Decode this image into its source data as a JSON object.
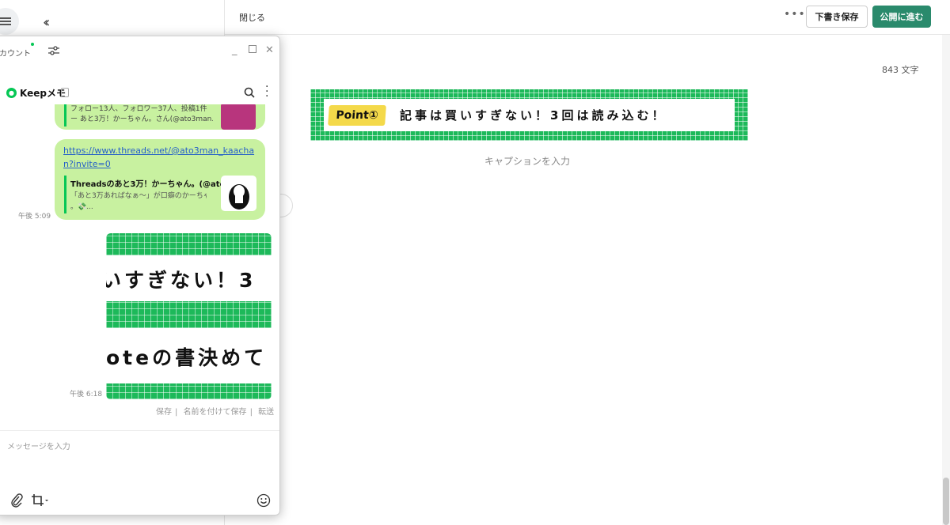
{
  "editor": {
    "close_label": "閉じる",
    "more_icon": "ellipsis-icon",
    "draft_label": "下書き保存",
    "publish_label": "公開に進む",
    "char_count": "843 文字",
    "caption_placeholder": "キャプションを入力",
    "banner": {
      "badge": "Point①",
      "text": "記事は買いすぎない！3回は読み込む！"
    },
    "colors": {
      "publish": "#2a8a6c",
      "banner_green": "#1db95a",
      "badge_yellow": "#f4d94a"
    }
  },
  "chat": {
    "account_label": "カウント",
    "title": "Keepメモ",
    "messages": {
      "top_partial_line1": "フォロー13人、フォロワー37人、投稿1件",
      "top_partial_line2": "ー あと3万！かーちゃん。さん(@ato3man...",
      "threads_link": "https://www.threads.net/@ato3man_kaachan?invite=0",
      "threads_title": "Threadsのあと3万！かーちゃん。(@ato...",
      "threads_desc_line1": "「あと3万あればなぁ〜」が口癖のかーちゃん",
      "threads_desc_line2": "。💸...",
      "threads_time": "午後 5:09",
      "image_text_line1": "いすぎない！3",
      "image_text_line2": "oteの書決めて",
      "image_time": "午後 6:18"
    },
    "actions": {
      "save": "保存",
      "save_as": "名前を付けて保存",
      "forward": "転送"
    },
    "input_placeholder": "メッセージを入力",
    "colors": {
      "bubble": "#c8f1a0",
      "online": "#06c755",
      "link": "#2560c8"
    }
  }
}
